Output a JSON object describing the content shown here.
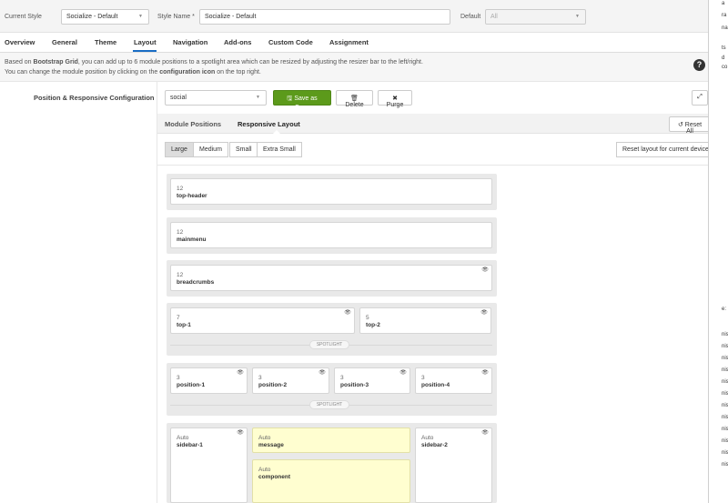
{
  "toolbar": {
    "current_style_label": "Current Style",
    "current_style_value": "Socialize - Default",
    "style_name_label": "Style Name *",
    "style_name_value": "Socialize - Default",
    "default_label": "Default",
    "default_value": "All"
  },
  "tabs": [
    {
      "label": "Overview"
    },
    {
      "label": "General"
    },
    {
      "label": "Theme"
    },
    {
      "label": "Layout",
      "active": true
    },
    {
      "label": "Navigation"
    },
    {
      "label": "Add-ons"
    },
    {
      "label": "Custom Code"
    },
    {
      "label": "Assignment"
    }
  ],
  "info": {
    "line1_a": "Based on ",
    "line1_b": "Bootstrap Grid",
    "line1_c": ", you can add up to 6 module positions to a spotlight area which can be resized by adjusting the resizer bar to the left/right.",
    "line2_a": "You can change the module position by clicking on the ",
    "line2_b": "configuration icon",
    "line2_c": " on the top right."
  },
  "section": {
    "label": "Position & Responsive Configuration",
    "layout_select": "social",
    "save_copy": "Save as Copy",
    "delete": "Delete",
    "purge": "Purge"
  },
  "panel": {
    "tab_positions": "Module Positions",
    "tab_responsive": "Responsive Layout",
    "reset_all": "Reset All",
    "reset_device": "Reset layout for current device",
    "devices": [
      "Large",
      "Medium",
      "Small",
      "Extra Small"
    ]
  },
  "rows": {
    "r1": {
      "width": "12",
      "name": "top-header"
    },
    "r2": {
      "width": "12",
      "name": "mainmenu"
    },
    "r3": {
      "width": "12",
      "name": "breadcrumbs"
    },
    "r4a": {
      "width": "7",
      "name": "top-1"
    },
    "r4b": {
      "width": "5",
      "name": "top-2"
    },
    "r4_spot": "SPOTLIGHT",
    "r5a": {
      "width": "3",
      "name": "position-1"
    },
    "r5b": {
      "width": "3",
      "name": "position-2"
    },
    "r5c": {
      "width": "3",
      "name": "position-3"
    },
    "r5d": {
      "width": "3",
      "name": "position-4"
    },
    "r5_spot": "SPOTLIGHT",
    "r6a": {
      "width": "Auto",
      "name": "sidebar-1"
    },
    "r6b": {
      "width": "Auto",
      "name": "message"
    },
    "r6c": {
      "width": "Auto",
      "name": "component"
    },
    "r6d": {
      "width": "Auto",
      "name": "sidebar-2"
    }
  },
  "right_strip": [
    "a",
    "ra",
    "na",
    "ts",
    "d",
    "co",
    "e:",
    "nis",
    "nis",
    "nis",
    "nis",
    "nis",
    "nis",
    "nis",
    "nis",
    "nis",
    "nis",
    "nis",
    "nis"
  ],
  "colors": {
    "accent": "#1a6dc5",
    "save_green": "#5c9a1b",
    "yellow_cell": "#fffed0"
  }
}
